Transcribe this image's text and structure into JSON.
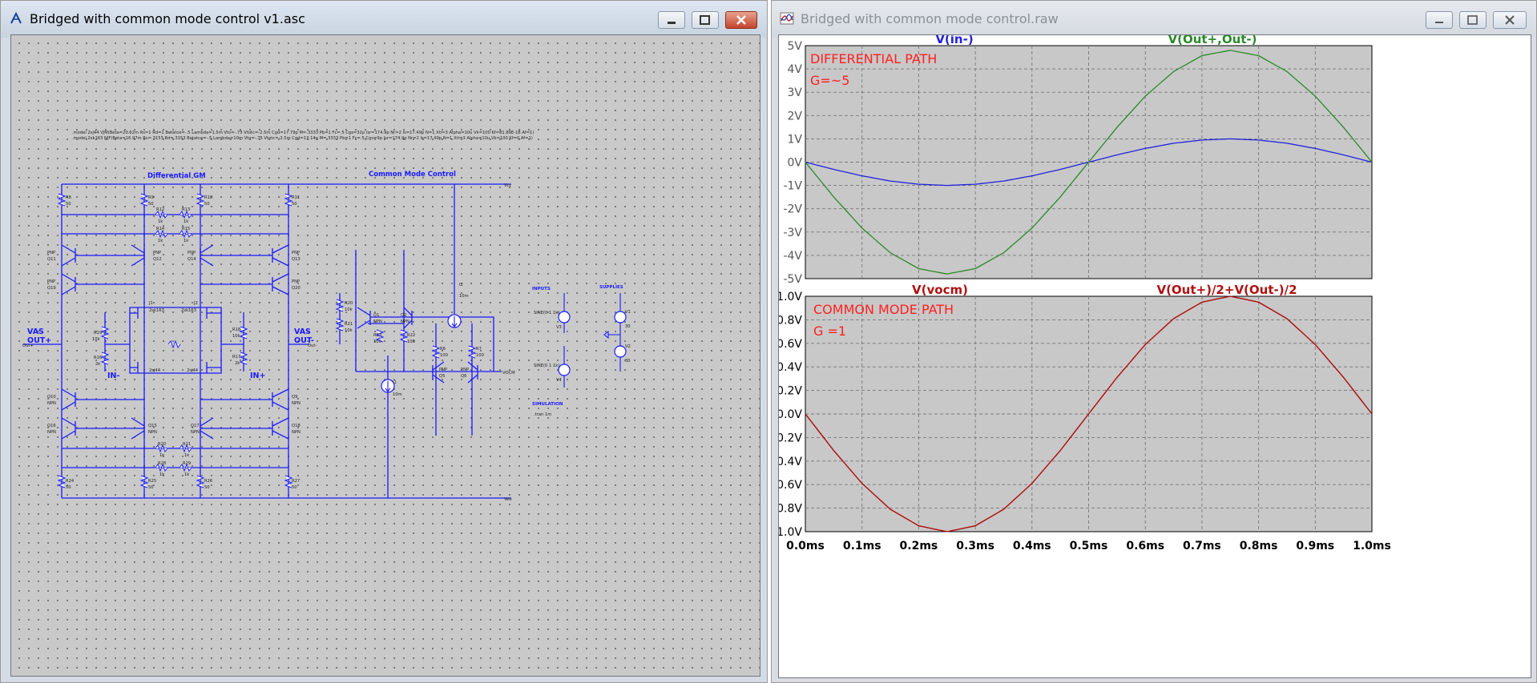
{
  "schematic_window": {
    "title": "Bridged with common mode control v1.asc",
    "model_lines": [
      ".model 2sj44 VJM(Beta=20.62m Rs=1 Rd=1 Betatce=-.5 Lambda=1.5m Vto=-.75 Vtotc=-2.5m Cgd=17.79p M=.3333 Pb=1 Fc=.5 Cgs=32p Isr=174.9p Nr=2 Is=17.49p N=1 Xti=3 Alpha=10u Vk=100 Kf=81.89E-18 Af=1)",
      ".model 2sk163 NJF(Beta=16.97m Rs=.3153 Rd=.3153 Betatce=-.5 Lambda=10m Vto=-.75 Vtotc=-2.5m Cgd=13.14p M=.3333 Pb=1 Fc=.5 Cgs=9p Isr=174.9p Nr=2 Is=17.49p N=1 Xti=3 Alpha=10u Vk=100 Kf=0 Af=1)"
    ],
    "labels": {
      "differential_gm": "Differential GM",
      "common_mode_control": "Common Mode Control",
      "vcc": "Vcc",
      "vee": "Vee",
      "vas_out_plus": "VAS\nOUT+",
      "vas_out_minus": "VAS\nOUT-",
      "out_plus": "Out+",
      "out_minus": "Out-",
      "in_minus": "IN-",
      "in_plus": "IN+",
      "vocm": "VOCM",
      "inputs": "INPUTS",
      "supplies": "SUPPLIES",
      "simulation": "SIMULATION",
      "tran": ".tran 1m",
      "sine": "SINE(0 1 1k)",
      "i2": "I2",
      "i1": "I1",
      "i_val": "10m",
      "v1": "V1",
      "v2": "V2",
      "v3": "V3",
      "v4": "V4",
      "v_val": "30"
    },
    "components": {
      "q11": "Q11",
      "q12": "Q12",
      "q14": "Q14",
      "q13": "Q13",
      "q19": "Q19",
      "q20": "Q20",
      "q10": "Q10",
      "q9": "Q9",
      "q16": "Q16",
      "q15": "Q15",
      "q17": "Q17",
      "q18": "Q18",
      "q1": "Q1",
      "q2": "Q2",
      "q5": "Q5",
      "q6": "Q6",
      "j1": "J1",
      "j2": "J2",
      "j3": "J3",
      "j4": "J4",
      "pnp": "PNP",
      "npn": "NPN",
      "jfet_n": "2sk163",
      "jfet_p": "2sj44",
      "r8": "R8",
      "r9": "R9",
      "r10": "R10",
      "r11": "R11",
      "r12": "R12",
      "r13": "R13",
      "r14": "R14",
      "r15": "R15",
      "r18": "R18",
      "r19": "R19",
      "r16": "R16",
      "r17": "R17",
      "r20": "R20",
      "r21": "R21",
      "r22": "R22",
      "r23": "R23",
      "r24": "R24",
      "r25": "R25",
      "r26": "R26",
      "r27": "R27",
      "r28": "R28",
      "r29": "R29",
      "val_50": "50",
      "val_1k": "1k",
      "val_10k": "10k",
      "val_100": "100",
      "val_22": "22",
      "val_2k": "2k"
    }
  },
  "plot_window": {
    "title": "Bridged with common mode control.raw",
    "panes": [
      {
        "traces": [
          {
            "label": "V(in-)",
            "color": "#2222dd"
          },
          {
            "label": "V(Out+,Out-)",
            "color": "#2a8a2a"
          }
        ],
        "annotation": [
          "DIFFERENTIAL PATH",
          "G=~5"
        ],
        "annotation_color": "#ff2020",
        "y_ticks": [
          "5V",
          "4V",
          "3V",
          "2V",
          "1V",
          "0V",
          "-1V",
          "-2V",
          "-3V",
          "-4V",
          "-5V"
        ],
        "ylim": [
          -5,
          5
        ]
      },
      {
        "traces": [
          {
            "label": "V(vocm)",
            "color": "#b01010"
          },
          {
            "label": "V(Out+)/2+V(Out-)/2",
            "color": "#b01010"
          }
        ],
        "annotation": [
          "COMMON MODE PATH",
          "G =1"
        ],
        "annotation_color": "#ff2020",
        "y_ticks": [
          "1.0V",
          "0.8V",
          "0.6V",
          "0.4V",
          "0.2V",
          "0.0V",
          "-0.2V",
          "-0.4V",
          "-0.6V",
          "-0.8V",
          "-1.0V"
        ],
        "ylim": [
          -1,
          1
        ]
      }
    ],
    "x_ticks": [
      "0.0ms",
      "0.1ms",
      "0.2ms",
      "0.3ms",
      "0.4ms",
      "0.5ms",
      "0.6ms",
      "0.7ms",
      "0.8ms",
      "0.9ms",
      "1.0ms"
    ]
  },
  "chart_data": [
    {
      "type": "line",
      "title": "",
      "xlabel": "",
      "ylabel": "",
      "xlim": [
        0,
        1.0
      ],
      "ylim": [
        -5,
        5
      ],
      "x": [
        0,
        0.05,
        0.1,
        0.15,
        0.2,
        0.25,
        0.3,
        0.35,
        0.4,
        0.45,
        0.5,
        0.55,
        0.6,
        0.65,
        0.7,
        0.75,
        0.8,
        0.85,
        0.9,
        0.95,
        1.0
      ],
      "series": [
        {
          "name": "V(in-)",
          "values": [
            0,
            -0.31,
            -0.59,
            -0.81,
            -0.95,
            -1.0,
            -0.95,
            -0.81,
            -0.59,
            -0.31,
            0,
            0.31,
            0.59,
            0.81,
            0.95,
            1.0,
            0.95,
            0.81,
            0.59,
            0.31,
            0
          ]
        },
        {
          "name": "V(Out+,Out-)",
          "values": [
            0,
            -1.49,
            -2.83,
            -3.89,
            -4.57,
            -4.8,
            -4.57,
            -3.89,
            -2.83,
            -1.49,
            0,
            1.49,
            2.83,
            3.89,
            4.57,
            4.8,
            4.57,
            3.89,
            2.83,
            1.49,
            0
          ]
        }
      ],
      "grid": true
    },
    {
      "type": "line",
      "title": "",
      "xlabel": "",
      "ylabel": "",
      "xlim": [
        0,
        1.0
      ],
      "ylim": [
        -1,
        1
      ],
      "x": [
        0,
        0.05,
        0.1,
        0.15,
        0.2,
        0.25,
        0.3,
        0.35,
        0.4,
        0.45,
        0.5,
        0.55,
        0.6,
        0.65,
        0.7,
        0.75,
        0.8,
        0.85,
        0.9,
        0.95,
        1.0
      ],
      "series": [
        {
          "name": "V(vocm)",
          "values": [
            0,
            -0.31,
            -0.59,
            -0.81,
            -0.95,
            -1.0,
            -0.95,
            -0.81,
            -0.59,
            -0.31,
            0,
            0.31,
            0.59,
            0.81,
            0.95,
            1.0,
            0.95,
            0.81,
            0.59,
            0.31,
            0
          ]
        },
        {
          "name": "V(Out+)/2+V(Out-)/2",
          "values": [
            0,
            -0.31,
            -0.59,
            -0.81,
            -0.95,
            -1.0,
            -0.95,
            -0.81,
            -0.59,
            -0.31,
            0,
            0.31,
            0.59,
            0.81,
            0.95,
            1.0,
            0.95,
            0.81,
            0.59,
            0.31,
            0
          ]
        }
      ],
      "grid": true
    }
  ]
}
